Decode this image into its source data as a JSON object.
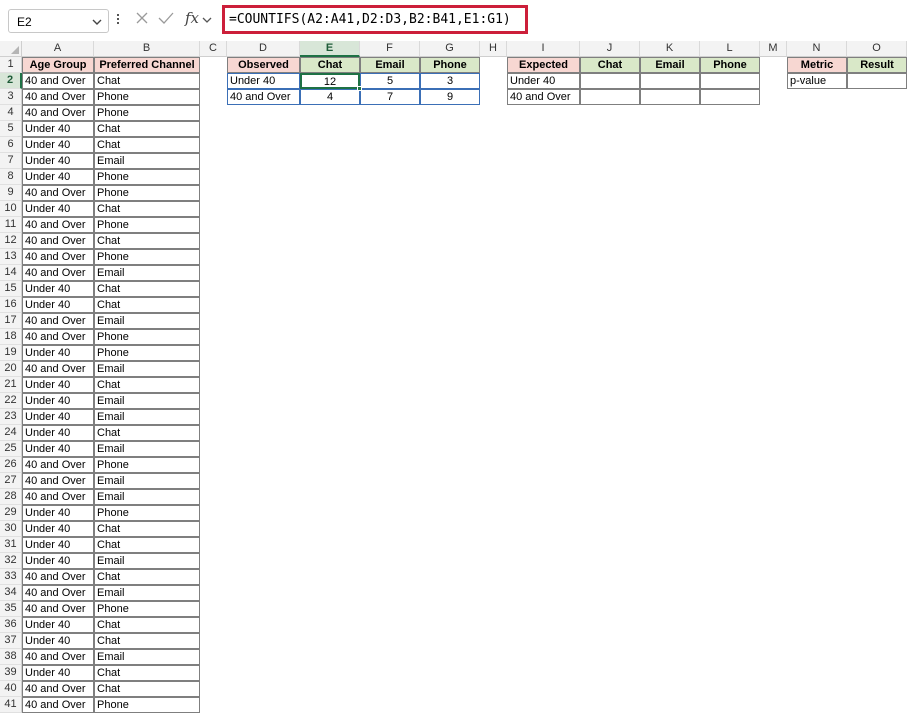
{
  "formula_bar": {
    "name_box": "E2",
    "fx_label": "fx",
    "formula": "=COUNTIFS(A2:A41,D2:D3,B2:B41,E1:G1)"
  },
  "columns": [
    "A",
    "B",
    "C",
    "D",
    "E",
    "F",
    "G",
    "H",
    "I",
    "J",
    "K",
    "L",
    "M",
    "N",
    "O"
  ],
  "selected_column": "E",
  "selected_row": 2,
  "source_table": {
    "headers": [
      "Age Group",
      "Preferred Channel"
    ],
    "rows": [
      [
        "40 and Over",
        "Chat"
      ],
      [
        "40 and Over",
        "Phone"
      ],
      [
        "40 and Over",
        "Phone"
      ],
      [
        "Under 40",
        "Chat"
      ],
      [
        "Under 40",
        "Chat"
      ],
      [
        "Under 40",
        "Email"
      ],
      [
        "Under 40",
        "Phone"
      ],
      [
        "40 and Over",
        "Phone"
      ],
      [
        "Under 40",
        "Chat"
      ],
      [
        "40 and Over",
        "Phone"
      ],
      [
        "40 and Over",
        "Chat"
      ],
      [
        "40 and Over",
        "Phone"
      ],
      [
        "40 and Over",
        "Email"
      ],
      [
        "Under 40",
        "Chat"
      ],
      [
        "Under 40",
        "Chat"
      ],
      [
        "40 and Over",
        "Email"
      ],
      [
        "40 and Over",
        "Phone"
      ],
      [
        "Under 40",
        "Phone"
      ],
      [
        "40 and Over",
        "Email"
      ],
      [
        "Under 40",
        "Chat"
      ],
      [
        "Under 40",
        "Email"
      ],
      [
        "Under 40",
        "Email"
      ],
      [
        "Under 40",
        "Chat"
      ],
      [
        "Under 40",
        "Email"
      ],
      [
        "40 and Over",
        "Phone"
      ],
      [
        "40 and Over",
        "Email"
      ],
      [
        "40 and Over",
        "Email"
      ],
      [
        "Under 40",
        "Phone"
      ],
      [
        "Under 40",
        "Chat"
      ],
      [
        "Under 40",
        "Chat"
      ],
      [
        "Under 40",
        "Email"
      ],
      [
        "40 and Over",
        "Chat"
      ],
      [
        "40 and Over",
        "Email"
      ],
      [
        "40 and Over",
        "Phone"
      ],
      [
        "Under 40",
        "Chat"
      ],
      [
        "Under 40",
        "Chat"
      ],
      [
        "40 and Over",
        "Email"
      ],
      [
        "Under 40",
        "Chat"
      ],
      [
        "40 and Over",
        "Chat"
      ],
      [
        "40 and Over",
        "Phone"
      ]
    ]
  },
  "observed_table": {
    "corner": "Observed",
    "headers": [
      "Chat",
      "Email",
      "Phone"
    ],
    "rows": [
      {
        "label": "Under 40",
        "values": [
          "12",
          "5",
          "3"
        ]
      },
      {
        "label": "40 and Over",
        "values": [
          "4",
          "7",
          "9"
        ]
      }
    ]
  },
  "expected_table": {
    "corner": "Expected",
    "headers": [
      "Chat",
      "Email",
      "Phone"
    ],
    "rows": [
      {
        "label": "Under 40",
        "values": [
          "",
          "",
          ""
        ]
      },
      {
        "label": "40 and Over",
        "values": [
          "",
          "",
          ""
        ]
      }
    ]
  },
  "metric_table": {
    "headers": [
      "Metric",
      "Result"
    ],
    "rows": [
      [
        "p-value",
        ""
      ]
    ]
  },
  "colors": {
    "header_pink": "#f7d7d2",
    "header_green": "#d9e8c8",
    "selection_green": "#1e7145",
    "formula_highlight": "#cc1f3a"
  }
}
